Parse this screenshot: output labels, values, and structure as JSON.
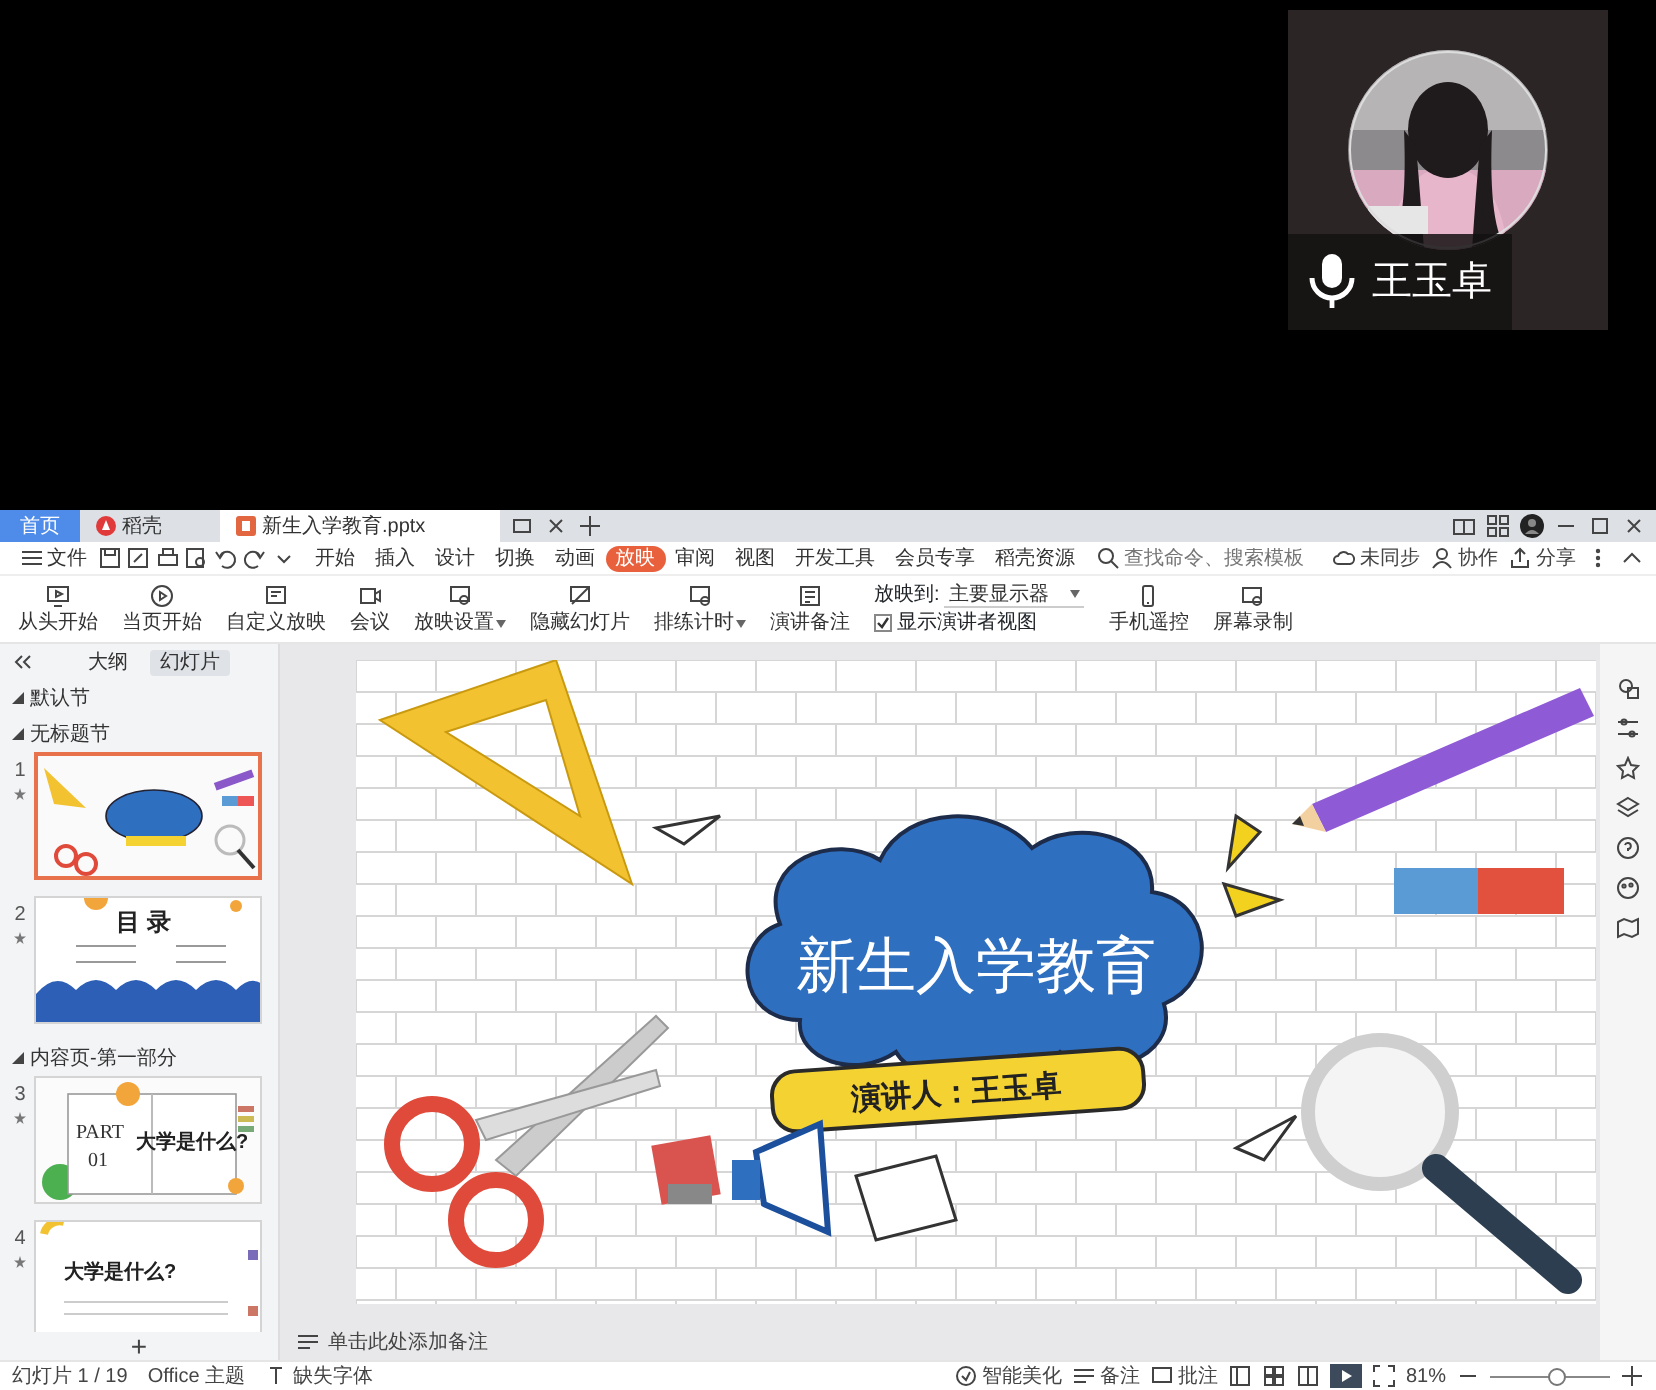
{
  "video_tile": {
    "name": "王玉卓"
  },
  "window": {
    "tabs": [
      {
        "label": "首页",
        "kind": "home",
        "selected": false
      },
      {
        "label": "稻壳",
        "kind": "app",
        "selected": false
      },
      {
        "label": "新生入学教育.pptx",
        "kind": "doc",
        "selected": true
      }
    ]
  },
  "menu": {
    "file": "文件",
    "items": [
      {
        "label": "开始",
        "selected": false
      },
      {
        "label": "插入",
        "selected": false
      },
      {
        "label": "设计",
        "selected": false
      },
      {
        "label": "切换",
        "selected": false
      },
      {
        "label": "动画",
        "selected": false
      },
      {
        "label": "放映",
        "selected": true
      },
      {
        "label": "审阅",
        "selected": false
      },
      {
        "label": "视图",
        "selected": false
      },
      {
        "label": "开发工具",
        "selected": false
      },
      {
        "label": "会员专享",
        "selected": false
      },
      {
        "label": "稻壳资源",
        "selected": false
      }
    ],
    "search": {
      "placeholder": "查找命令、搜索模板"
    },
    "actions": [
      "未同步",
      "协作",
      "分享"
    ]
  },
  "ribbon": {
    "buttons": [
      {
        "label": "从头开始",
        "dropdown": false
      },
      {
        "label": "当页开始",
        "dropdown": false
      },
      {
        "label": "自定义放映",
        "dropdown": false
      },
      {
        "label": "会议",
        "dropdown": false
      },
      {
        "label": "放映设置",
        "dropdown": true
      },
      {
        "label": "隐藏幻灯片",
        "dropdown": false
      },
      {
        "label": "排练计时",
        "dropdown": true
      },
      {
        "label": "演讲备注",
        "dropdown": false
      }
    ],
    "display_to": {
      "label": "放映到:",
      "value": "主要显示器"
    },
    "presenter_view": {
      "label": "显示演讲者视图",
      "checked": true
    },
    "buttons_after": [
      "手机遥控",
      "屏幕录制"
    ]
  },
  "panel": {
    "tabs": [
      {
        "label": "大纲",
        "selected": false
      },
      {
        "label": "幻灯片",
        "selected": true
      }
    ],
    "outline": [
      {
        "kind": "section",
        "label": "默认节"
      },
      {
        "kind": "section",
        "label": "无标题节"
      },
      {
        "kind": "cover",
        "number": "1",
        "selected": true
      },
      {
        "kind": "toc",
        "number": "2",
        "selected": false,
        "texts": [
          "目 录"
        ]
      },
      {
        "kind": "section",
        "label": "内容页-第一部分"
      },
      {
        "kind": "part",
        "number": "3",
        "selected": false,
        "texts": [
          "PART",
          "01",
          "大学是什么?"
        ]
      },
      {
        "kind": "content",
        "number": "4",
        "selected": false,
        "texts": [
          "大学是什么?"
        ]
      }
    ],
    "add": "+"
  },
  "slide": {
    "title": "新生入学教育",
    "speaker": "演讲人：王玉卓"
  },
  "notes": {
    "placeholder": "单击此处添加备注"
  },
  "status": {
    "slide_count": "幻灯片 1 / 19",
    "theme": "Office 主题",
    "missing_fonts": "缺失字体",
    "beautify": "智能美化",
    "notes": "备注",
    "comments": "批注",
    "zoom": {
      "reading": "81%",
      "level": 0.55
    }
  }
}
